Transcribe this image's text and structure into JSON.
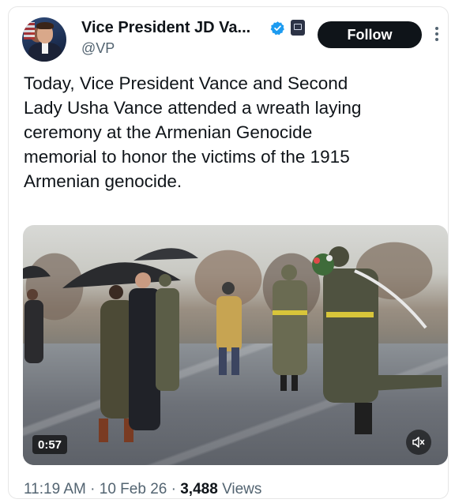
{
  "author": {
    "display_name": "Vice President JD Va...",
    "handle": "@VP",
    "verified_icon": "verified-badge-icon",
    "affiliation_icon": "government-badge-icon"
  },
  "actions": {
    "follow_label": "Follow",
    "more_icon": "more-options-icon"
  },
  "tweet": {
    "text": "Today, Vice President Vance and Second\nLady Usha Vance attended a wreath laying\nceremony at the Armenian Genocide\nmemorial to honor the victims of the 1915\nArmenian genocide."
  },
  "media": {
    "type": "video",
    "duration": "0:57",
    "mute_icon": "speaker-muted-icon"
  },
  "meta": {
    "time": "11:19 AM",
    "separator": "·",
    "date": "10 Feb 26",
    "views_count": "3,488",
    "views_label": "Views"
  },
  "colors": {
    "text_primary": "#0f1419",
    "text_secondary": "#536471",
    "follow_bg": "#0f1419",
    "verified_blue": "#1d9bf0"
  }
}
